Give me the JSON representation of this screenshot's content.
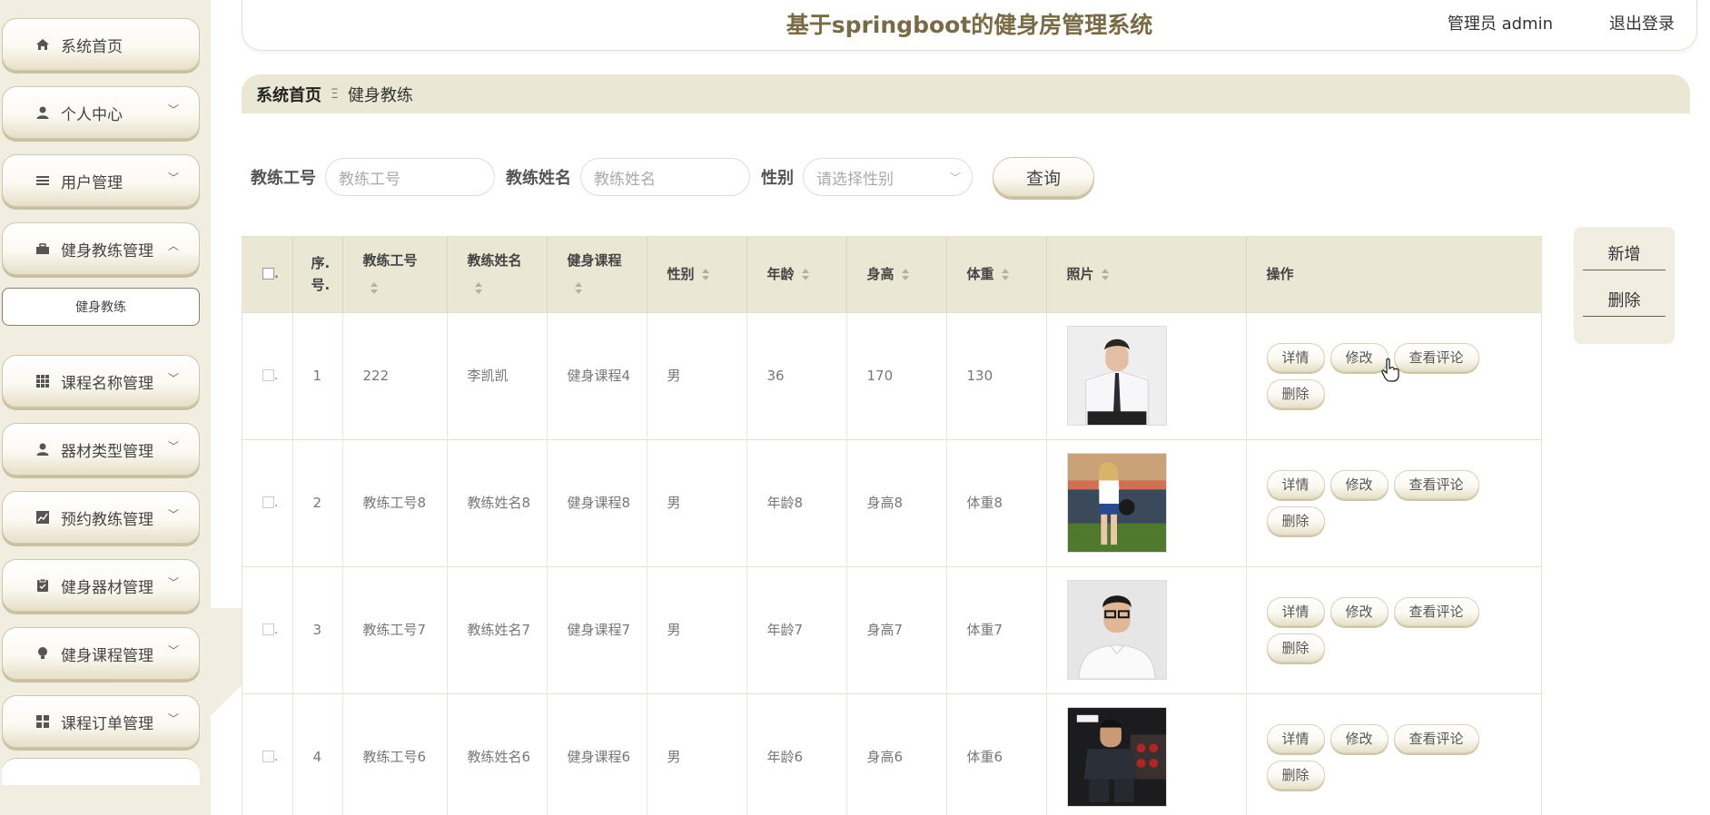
{
  "sidebar": {
    "items": [
      {
        "label": "系统首页",
        "icon": "home-icon",
        "arrow": ""
      },
      {
        "label": "个人中心",
        "icon": "user-icon",
        "arrow": "﹀"
      },
      {
        "label": "用户管理",
        "icon": "list-icon",
        "arrow": "﹀"
      },
      {
        "label": "健身教练管理",
        "icon": "briefcase-icon",
        "arrow": "︿"
      },
      {
        "label": "课程名称管理",
        "icon": "grid-icon",
        "arrow": "﹀"
      },
      {
        "label": "器材类型管理",
        "icon": "user-icon",
        "arrow": "﹀"
      },
      {
        "label": "预约教练管理",
        "icon": "chart-icon",
        "arrow": "﹀"
      },
      {
        "label": "健身器材管理",
        "icon": "clipboard-icon",
        "arrow": "﹀"
      },
      {
        "label": "健身课程管理",
        "icon": "bulb-icon",
        "arrow": "﹀"
      },
      {
        "label": "课程订单管理",
        "icon": "apps-icon",
        "arrow": "﹀"
      }
    ],
    "submenu": {
      "label": "健身教练"
    }
  },
  "header": {
    "title": "基于springboot的健身房管理系统",
    "user": "管理员 admin",
    "logout": "退出登录"
  },
  "breadcrumb": {
    "home": "系统首页",
    "separator": "Ξ",
    "current": "健身教练"
  },
  "search": {
    "code_label": "教练工号",
    "code_placeholder": "教练工号",
    "name_label": "教练姓名",
    "name_placeholder": "教练姓名",
    "gender_label": "性别",
    "gender_placeholder": "请选择性别",
    "query_button": "查询"
  },
  "actions": {
    "add": "新增",
    "delete": "删除"
  },
  "table": {
    "headers": {
      "index": "序.号.",
      "code": "教练工号",
      "name": "教练姓名",
      "course": "健身课程",
      "gender": "性别",
      "age": "年龄",
      "height": "身高",
      "weight": "体重",
      "photo": "照片",
      "ops": "操作"
    },
    "row_buttons": {
      "detail": "详情",
      "edit": "修改",
      "comments": "查看评论",
      "delete": "删除"
    },
    "rows": [
      {
        "index": "1",
        "code": "222",
        "name": "李凯凯",
        "course": "健身课程4",
        "gender": "男",
        "age": "36",
        "height": "170",
        "weight": "130",
        "photo": "man-in-suit-photo"
      },
      {
        "index": "2",
        "code": "教练工号8",
        "name": "教练姓名8",
        "course": "健身课程8",
        "gender": "男",
        "age": "年龄8",
        "height": "身高8",
        "weight": "体重8",
        "photo": "woman-with-ball-photo"
      },
      {
        "index": "3",
        "code": "教练工号7",
        "name": "教练姓名7",
        "course": "健身课程7",
        "gender": "男",
        "age": "年龄7",
        "height": "身高7",
        "weight": "体重7",
        "photo": "man-with-glasses-photo"
      },
      {
        "index": "4",
        "code": "教练工号6",
        "name": "教练姓名6",
        "course": "健身课程6",
        "gender": "男",
        "age": "年龄6",
        "height": "身高6",
        "weight": "体重6",
        "photo": "man-in-gym-photo"
      }
    ]
  },
  "colors": {
    "sidebar_bg": "#f1ede0",
    "title": "#7a6b45",
    "header_band": "#ebe7d5"
  }
}
